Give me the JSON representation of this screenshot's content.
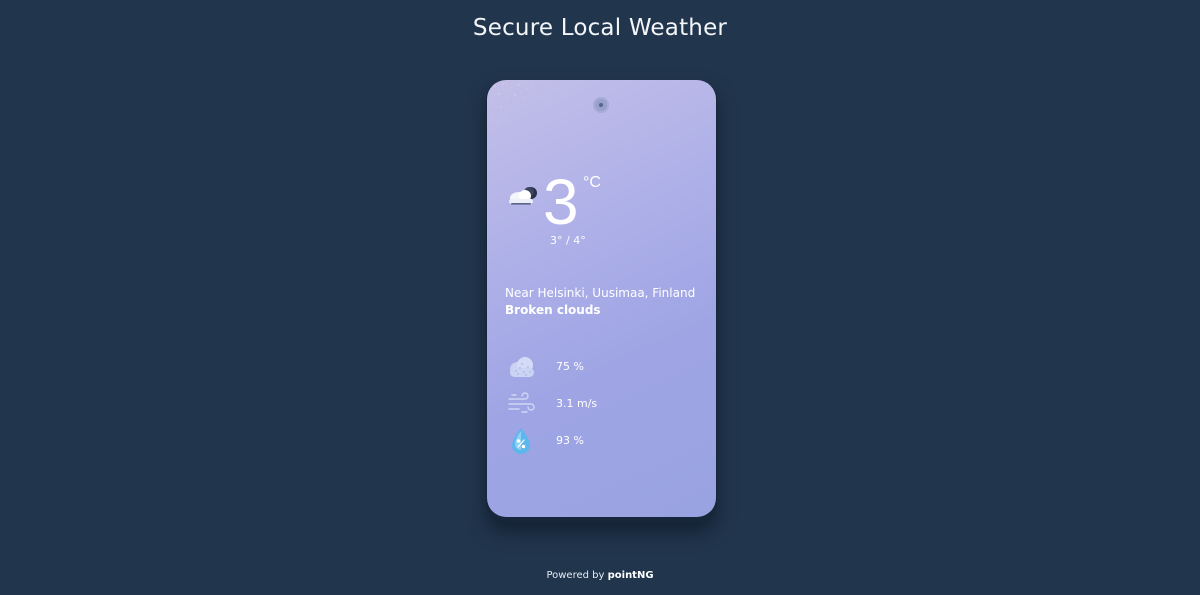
{
  "header": {
    "title": "Secure Local Weather"
  },
  "weather": {
    "condition_icon": "cloud-moon-icon",
    "temperature": "3",
    "unit": "°C",
    "range": "3° / 4°",
    "location": "Near Helsinki, Uusimaa, Finland",
    "condition": "Broken clouds"
  },
  "stats": [
    {
      "icon": "cloud-icon",
      "value": "75 %"
    },
    {
      "icon": "wind-icon",
      "value": "3.1 m/s"
    },
    {
      "icon": "humidity-drop-icon",
      "value": "93 %"
    }
  ],
  "footer": {
    "prefix": "Powered by",
    "brand": "pointNG"
  },
  "colors": {
    "background": "#21354d",
    "card_gradient_start": "#c3bfe8",
    "card_gradient_end": "#9aa3e2",
    "text": "#ffffff"
  }
}
